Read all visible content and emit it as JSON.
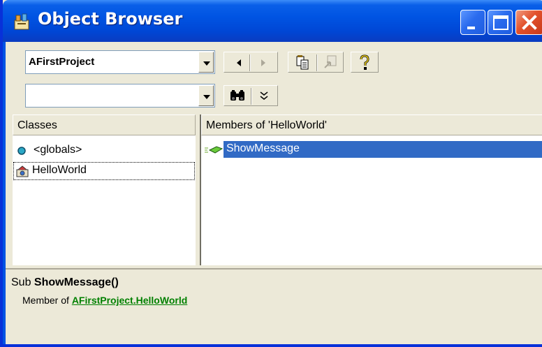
{
  "window": {
    "title": "Object Browser",
    "colors": {
      "titlebar": "#0054E3",
      "face": "#ECE9D8",
      "selection": "#316AC5",
      "link": "#008000"
    }
  },
  "toolbar": {
    "library_combo_value": "AFirstProject",
    "search_combo_value": "",
    "icons": [
      "back-icon",
      "forward-icon",
      "copy-icon",
      "view-definition-icon",
      "help-icon",
      "binoculars-icon",
      "show-search-results-icon"
    ]
  },
  "classes_pane": {
    "header": "Classes",
    "items": [
      {
        "label": "<globals>",
        "icon": "globals-icon"
      },
      {
        "label": "HelloWorld",
        "icon": "class-module-icon"
      }
    ]
  },
  "members_pane": {
    "header": "Members of 'HelloWorld'",
    "items": [
      {
        "label": "ShowMessage",
        "icon": "method-icon"
      }
    ]
  },
  "details": {
    "prefix": "Sub ",
    "member_signature": "ShowMessage()",
    "member_of_text": "Member of ",
    "project_link": "AFirstProject",
    "dot": ".",
    "class_link": "HelloWorld"
  }
}
